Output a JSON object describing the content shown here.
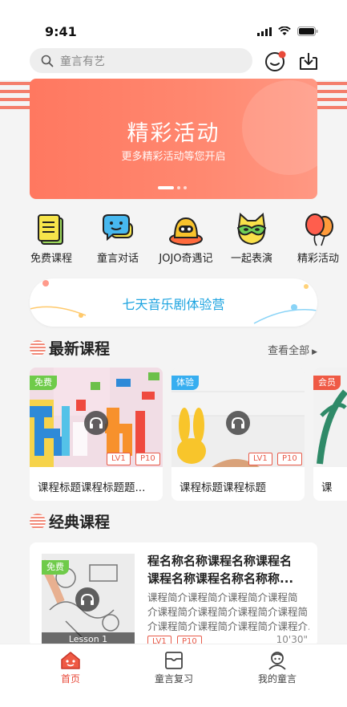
{
  "status": {
    "time": "9:41"
  },
  "search": {
    "placeholder": "童言有艺"
  },
  "banner": {
    "title": "精彩活动",
    "subtitle": "更多精彩活动等您开启"
  },
  "categories": [
    {
      "label": "免费课程",
      "icon": "free-course-icon"
    },
    {
      "label": "童言对话",
      "icon": "chat-icon"
    },
    {
      "label": "JOJO奇遇记",
      "icon": "jojo-icon"
    },
    {
      "label": "一起表演",
      "icon": "mask-icon"
    },
    {
      "label": "精彩活动",
      "icon": "balloon-icon"
    }
  ],
  "camp": {
    "label": "七天音乐剧体验营"
  },
  "latest": {
    "title": "最新课程",
    "more": "查看全部",
    "courses": [
      {
        "tag": "免费",
        "title": "课程标题课程标题题...",
        "lv": "LV1",
        "p": "P10"
      },
      {
        "tag": "体验",
        "title": "课程标题课程标题",
        "lv": "LV1",
        "p": "P10"
      },
      {
        "tag": "会员",
        "title": "课"
      }
    ]
  },
  "classic": {
    "title": "经典课程",
    "item": {
      "tag": "免费",
      "name_line1": "程名称名称课程名称课程名",
      "name_line2": "课程名称课程名称名称称...",
      "desc_line1": "课程简介课程简介课程简介课程简",
      "desc_line2": "介课程简介课程简介课程简介课程简",
      "desc_line3": "介课程简介课程简介课程简介课程介...",
      "image_caption": "Lesson 1",
      "lv": "LV1",
      "p": "P10",
      "duration": "10'30\""
    }
  },
  "tabs": [
    {
      "label": "首页",
      "active": true
    },
    {
      "label": "童言复习",
      "active": false
    },
    {
      "label": "我的童言",
      "active": false
    }
  ],
  "colors": {
    "accent": "#e84a3a",
    "banner": "#ff8068",
    "camp_text": "#1ea4e0"
  }
}
